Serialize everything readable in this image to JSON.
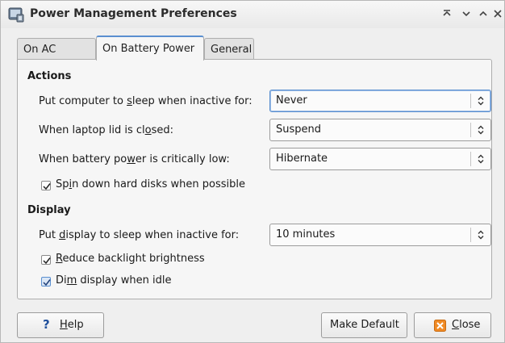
{
  "window": {
    "title": "Power Management Preferences",
    "controls": [
      "keep-above",
      "minimize",
      "maximize",
      "close"
    ]
  },
  "tabs": [
    {
      "label": "On AC Power",
      "active": false
    },
    {
      "label": "On Battery Power",
      "active": true
    },
    {
      "label": "General",
      "active": false
    }
  ],
  "actions": {
    "heading": "Actions",
    "sleep": {
      "label_pre": "Put computer to ",
      "label_u": "s",
      "label_post": "leep when inactive for:",
      "value": "Never"
    },
    "lid": {
      "label_pre": "When laptop lid is cl",
      "label_u": "o",
      "label_post": "sed:",
      "value": "Suspend"
    },
    "battery": {
      "label_pre": "When battery po",
      "label_u": "w",
      "label_post": "er is critically low:",
      "value": "Hibernate"
    },
    "spin": {
      "label_pre": "Sp",
      "label_u": "i",
      "label_post": "n down hard disks when possible",
      "checked": true
    }
  },
  "display": {
    "heading": "Display",
    "sleep": {
      "label_pre": "Put ",
      "label_u": "d",
      "label_post": "isplay to sleep when inactive for:",
      "value": "10 minutes"
    },
    "backlight": {
      "label_pre": "",
      "label_u": "R",
      "label_post": "educe backlight brightness",
      "checked": true
    },
    "dim": {
      "label_pre": "Di",
      "label_u": "m",
      "label_post": " display when idle",
      "checked": true
    }
  },
  "buttons": {
    "help": {
      "icon": "?",
      "label_u": "H",
      "label_post": "elp"
    },
    "make_default": {
      "label": "Make Default"
    },
    "close": {
      "label_u": "C",
      "label_post": "lose"
    }
  },
  "colors": {
    "accent": "#5a8fd0",
    "close_icon": "#f08a24",
    "help_icon": "#1f4f9c"
  }
}
